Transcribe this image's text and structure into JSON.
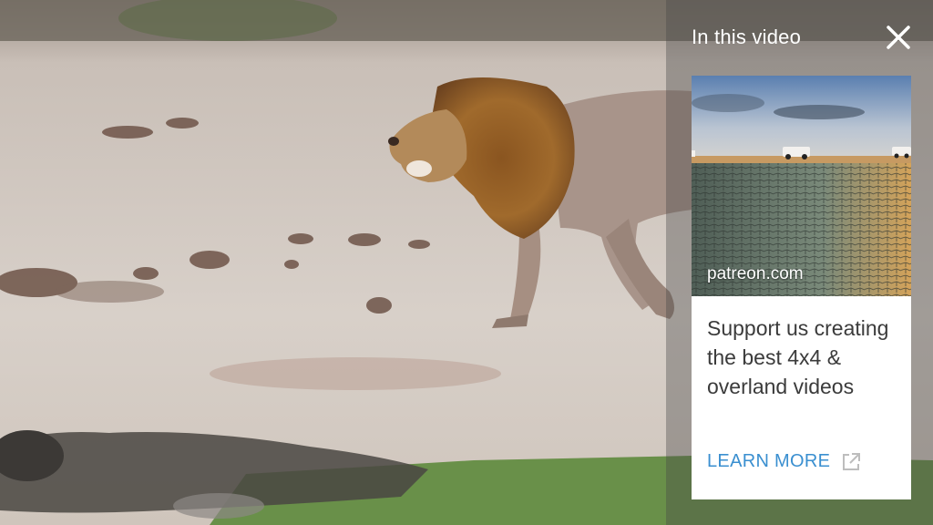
{
  "panel": {
    "title": "In this video",
    "close_icon": "close-icon"
  },
  "card": {
    "domain": "patreon.com",
    "headline": "Support us creating the best 4x4 & overland videos",
    "cta_label": "LEARN MORE",
    "cta_icon": "external-link-icon"
  },
  "colors": {
    "cta": "#3a8fd0",
    "headline": "#3b3b3b",
    "panel_overlay": "rgba(70,70,70,0.38)"
  }
}
